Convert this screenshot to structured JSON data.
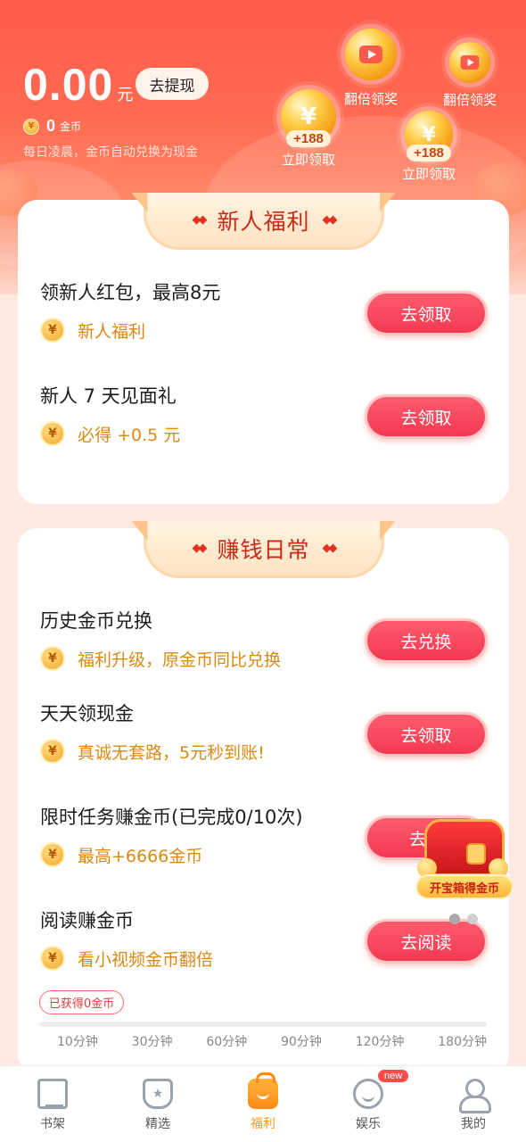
{
  "header": {
    "balance": "0.00",
    "balance_unit": "元",
    "withdraw_label": "去提现",
    "coin_count": "0",
    "coin_unit": "金币",
    "notice": "每日凌晨，金币自动兑换为现金",
    "bubbles": [
      {
        "label": "翻倍领奖",
        "type": "video"
      },
      {
        "label": "翻倍领奖",
        "type": "video"
      },
      {
        "amount": "+188",
        "label": "立即领取",
        "type": "coin"
      },
      {
        "amount": "+188",
        "label": "立即领取",
        "type": "coin"
      }
    ]
  },
  "sections": [
    {
      "title": "新人福利",
      "tasks": [
        {
          "title": "领新人红包，最高8元",
          "subtitle": "新人福利",
          "button": "去领取"
        },
        {
          "title": "新人 7 天见面礼",
          "subtitle": "必得 +0.5 元",
          "button": "去领取"
        }
      ]
    },
    {
      "title": "赚钱日常",
      "tasks": [
        {
          "title": "历史金币兑换",
          "subtitle": "福利升级，原金币同比兑换",
          "button": "去兑换"
        },
        {
          "title": "天天领现金",
          "subtitle": "真诚无套路，5元秒到账!",
          "button": "去领取"
        },
        {
          "title": "限时任务赚金币(已完成0/10次)",
          "subtitle": "最高+6666金币",
          "button": "去赚"
        },
        {
          "title": "阅读赚金币",
          "subtitle": "看小视频金币翻倍",
          "button": "去阅读"
        }
      ]
    }
  ],
  "treasure": {
    "label": "开宝箱得金币"
  },
  "reading_progress": {
    "earned_label": "已获得0金币",
    "progress": 0,
    "ticks": [
      "10分钟",
      "30分钟",
      "60分钟",
      "90分钟",
      "120分钟",
      "180分钟"
    ]
  },
  "nav": {
    "items": [
      {
        "label": "书架",
        "icon": "bookshelf-icon"
      },
      {
        "label": "精选",
        "icon": "featured-icon"
      },
      {
        "label": "福利",
        "icon": "gift-icon",
        "active": true
      },
      {
        "label": "娱乐",
        "icon": "entertainment-icon",
        "badge": "new"
      },
      {
        "label": "我的",
        "icon": "profile-icon"
      }
    ]
  },
  "colors": {
    "primary": "#ff5a4c",
    "button": "#f23a52",
    "coin_text": "#d98a14",
    "active_tab": "#f39b12"
  }
}
